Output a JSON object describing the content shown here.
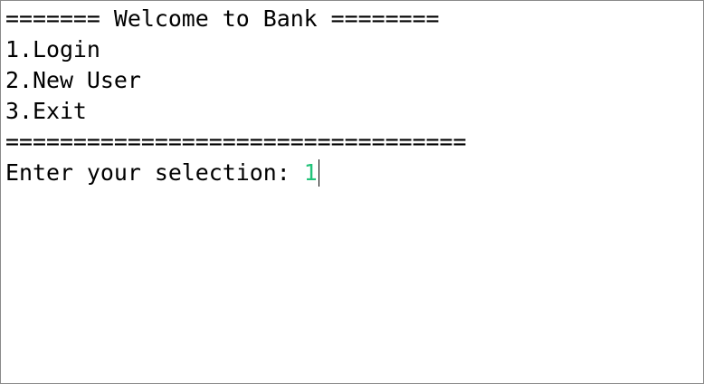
{
  "console": {
    "header": "======= Welcome to Bank ========",
    "menu": [
      "1.Login",
      "2.New User",
      "3.Exit"
    ],
    "separator": "==================================",
    "prompt": {
      "label": "Enter your selection: ",
      "value": "1"
    }
  },
  "colors": {
    "text": "#000000",
    "input_value": "#22c37a",
    "background": "#ffffff",
    "border": "#8a8a8a"
  }
}
